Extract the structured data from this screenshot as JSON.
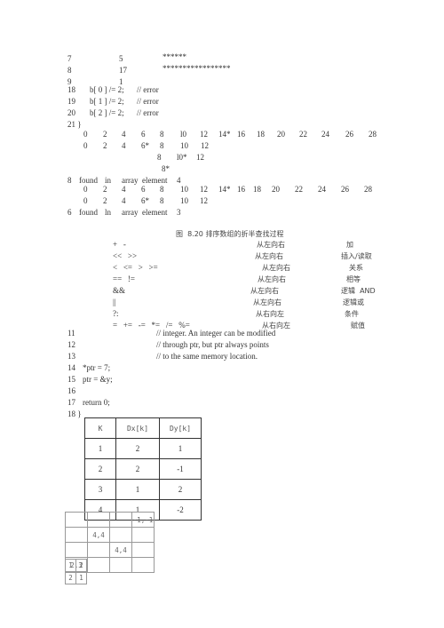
{
  "histogram_rows": [
    {
      "line": "7",
      "value": "5",
      "bar": "******"
    },
    {
      "line": "8",
      "value": "17",
      "bar": "*****************"
    },
    {
      "line": "9",
      "value": "1",
      "bar": ""
    }
  ],
  "error_lines": [
    {
      "line": "18",
      "code": "b[ 0 ] /= 2;",
      "comment": "// error"
    },
    {
      "line": "19",
      "code": "b[ 1 ] /= 2;",
      "comment": "// error"
    },
    {
      "line": "20",
      "code": "b[ 2 ] /= 2;",
      "comment": "// error"
    },
    {
      "line": "21 }",
      "code": "",
      "comment": ""
    }
  ],
  "search1": {
    "row1": [
      "0",
      "2",
      "4",
      "6",
      "8",
      "l0",
      "12",
      "14*",
      "16",
      "18",
      "20",
      "22",
      "24",
      "26",
      "28"
    ],
    "row2": [
      "0",
      "2",
      "4",
      "6*",
      "8",
      "10",
      "12"
    ],
    "row3": [
      "8",
      "l0*",
      "12"
    ],
    "row4": [
      "8*"
    ],
    "result": [
      "8",
      "found",
      "in",
      "array",
      "element",
      "4"
    ]
  },
  "search2": {
    "row1": [
      "0",
      "2",
      "4",
      "6",
      "8",
      "10",
      "12",
      "14*",
      "16",
      "18",
      "20",
      "22",
      "24",
      "26",
      "28"
    ],
    "row2": [
      "0",
      "2",
      "4",
      "6*",
      "8",
      "10",
      "12"
    ],
    "result": [
      "6",
      "found",
      "ln",
      "array",
      "element",
      "3"
    ]
  },
  "caption": "图  8.20 排序数组的折半查找过程",
  "operators": [
    {
      "ops": "+   -",
      "assoc": "从左向右",
      "type": "加"
    },
    {
      "ops": "<<   >>",
      "assoc": "从左向右",
      "type": "插入/读取"
    },
    {
      "ops": "<   <=   >   >=",
      "assoc": "从左向右",
      "type": "关系"
    },
    {
      "ops": "==   !=",
      "assoc": "从左向右",
      "type": "相等"
    },
    {
      "ops": "&&",
      "assoc": "从左向右",
      "type": "逻辑  AND"
    },
    {
      "ops": "||",
      "assoc": "从左向右",
      "type": "逻辑或"
    },
    {
      "ops": "?:",
      "assoc": "从右向左",
      "type": "条件"
    },
    {
      "ops": "=   +=   -=   *=   /=   %=",
      "assoc": "从右向左",
      "type": "赋值"
    }
  ],
  "code_lines": [
    {
      "line": "11",
      "code": "",
      "comment": "// integer. An integer can be modified"
    },
    {
      "line": "12",
      "code": "",
      "comment": "// through ptr, but ptr always points"
    },
    {
      "line": "13",
      "code": "",
      "comment": "// to the same memory location."
    },
    {
      "line": "14",
      "code": "*ptr = 7;",
      "comment": ""
    },
    {
      "line": "15",
      "code": "ptr = &y;",
      "comment": ""
    },
    {
      "line": "16",
      "code": "",
      "comment": ""
    },
    {
      "line": "17",
      "code": "return 0;",
      "comment": ""
    },
    {
      "line": "18 }",
      "code": "",
      "comment": ""
    }
  ],
  "k_table": {
    "headers": [
      "K",
      "Dx[k]",
      "Dy[k]"
    ],
    "rows": [
      [
        "1",
        "2",
        "1"
      ],
      [
        "2",
        "2",
        "-1"
      ],
      [
        "3",
        "1",
        "2"
      ],
      [
        "4",
        "1",
        "-2"
      ]
    ]
  },
  "grid": {
    "rows": [
      [
        "",
        "",
        "",
        "-1,-1"
      ],
      [
        "",
        "4,4",
        "",
        ""
      ],
      [
        "",
        "",
        "4,4",
        ""
      ],
      [
        "2,3",
        "",
        "",
        ""
      ]
    ],
    "small_rows": [
      [
        "1",
        "2"
      ],
      [
        "2",
        "1"
      ]
    ]
  }
}
